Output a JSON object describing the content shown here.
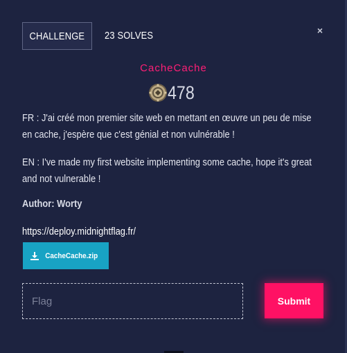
{
  "colors": {
    "modal_background": "#1d2340",
    "accent_pink": "#ff1f76",
    "submit_button": "#ff1164",
    "download_button": "#18a3c4"
  },
  "tabs": [
    {
      "label": "CHALLENGE",
      "active": true
    },
    {
      "label": "23 SOLVES",
      "active": false
    }
  ],
  "close_icon": {
    "glyph": "×",
    "name": "close-icon"
  },
  "challenge": {
    "name": "CacheCache",
    "value": "478",
    "value_icon": "coin-icon",
    "description_fr": "FR : J'ai créé mon premier site web en mettant en œuvre un peu de mise en cache, j'espère que c'est génial et non vulnérable !",
    "description_en": "EN : I've made my first website implementing some cache, hope it's great and not vulnerable !",
    "author": "Author: Worty",
    "link": "https://deploy.midnightflag.fr/",
    "download": {
      "label": "CacheCache.zip",
      "icon": "download-icon"
    }
  },
  "flag_input": {
    "placeholder": "Flag",
    "value": ""
  },
  "submit": {
    "label": "Submit"
  }
}
